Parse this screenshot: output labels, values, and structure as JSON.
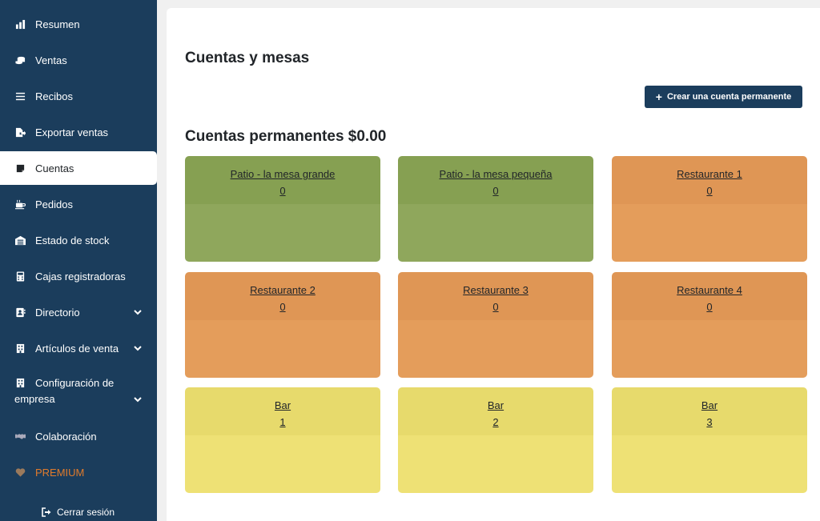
{
  "sidebar": {
    "items": [
      {
        "label": "Resumen",
        "icon": "bar-chart-icon"
      },
      {
        "label": "Ventas",
        "icon": "coins-icon"
      },
      {
        "label": "Recibos",
        "icon": "list-icon"
      },
      {
        "label": "Exportar ventas",
        "icon": "file-export-icon"
      },
      {
        "label": "Cuentas",
        "icon": "note-icon"
      },
      {
        "label": "Pedidos",
        "icon": "coffee-icon"
      },
      {
        "label": "Estado de stock",
        "icon": "warehouse-icon"
      },
      {
        "label": "Cajas registradoras",
        "icon": "calculator-icon"
      },
      {
        "label": "Directorio",
        "icon": "address-book-icon"
      },
      {
        "label": "Artículos de venta",
        "icon": "building-icon"
      },
      {
        "label": "Configuración de empresa",
        "icon": "building-icon"
      },
      {
        "label": "Colaboración",
        "icon": "handshake-icon"
      },
      {
        "label": "PREMIUM",
        "icon": "heart-icon"
      }
    ],
    "logout": "Cerrar sesión",
    "premium_color": "#e07b2c",
    "bg_color": "#1b3d5c"
  },
  "main": {
    "title": "Cuentas y mesas",
    "create_button": "Crear una cuenta permanente",
    "section_title": "Cuentas permanentes $0.00",
    "cards": [
      {
        "name": "Patio - la mesa grande",
        "value": "0",
        "color": "green"
      },
      {
        "name": "Patio - la mesa pequeña",
        "value": "0",
        "color": "green"
      },
      {
        "name": "Restaurante 1",
        "value": "0",
        "color": "orange"
      },
      {
        "name": "Restaurante 2",
        "value": "0",
        "color": "orange"
      },
      {
        "name": "Restaurante 3",
        "value": "0",
        "color": "orange"
      },
      {
        "name": "Restaurante 4",
        "value": "0",
        "color": "orange"
      },
      {
        "name": "Bar",
        "value": "1",
        "color": "yellow"
      },
      {
        "name": "Bar",
        "value": "2",
        "color": "yellow"
      },
      {
        "name": "Bar",
        "value": "3",
        "color": "yellow"
      }
    ]
  }
}
